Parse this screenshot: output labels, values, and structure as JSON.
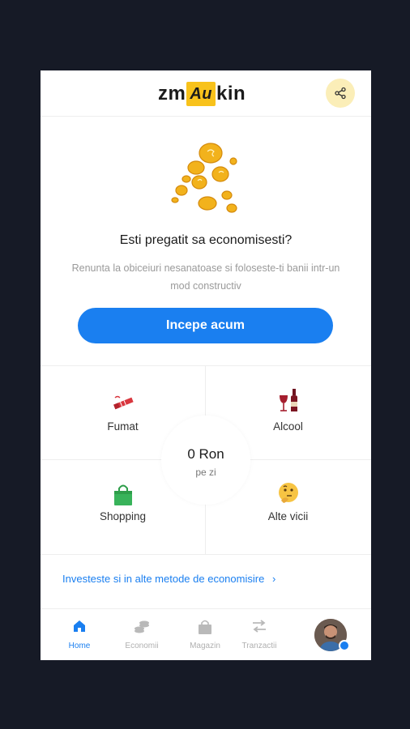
{
  "header": {
    "logo_left": "zm",
    "logo_mid": "Au",
    "logo_right": "kin",
    "share_icon": "share-icon"
  },
  "hero": {
    "title": "Esti pregatit sa economisesti?",
    "description": "Renunta la obiceiuri nesanatoase si foloseste-ti banii intr-un mod constructiv",
    "cta_label": "Incepe acum"
  },
  "categories": [
    {
      "label": "Fumat",
      "icon": "cigarette-icon"
    },
    {
      "label": "Alcool",
      "icon": "wine-icon"
    },
    {
      "label": "Shopping",
      "icon": "shopping-bag-icon"
    },
    {
      "label": "Alte vicii",
      "icon": "thinking-face-icon"
    }
  ],
  "savings": {
    "amount": "0 Ron",
    "period": "pe zi"
  },
  "invest_link": "Investeste si in alte metode de economisire",
  "nav": [
    {
      "label": "Home",
      "icon": "home-icon",
      "active": true
    },
    {
      "label": "Economii",
      "icon": "coins-icon",
      "active": false
    },
    {
      "label": "Magazin",
      "icon": "shop-bag-icon",
      "active": false
    },
    {
      "label": "Tranzactii",
      "icon": "transfer-arrows-icon",
      "active": false
    }
  ],
  "colors": {
    "accent": "#1a7ff0",
    "brand_yellow": "#f8c21b",
    "background": "#161a26"
  }
}
